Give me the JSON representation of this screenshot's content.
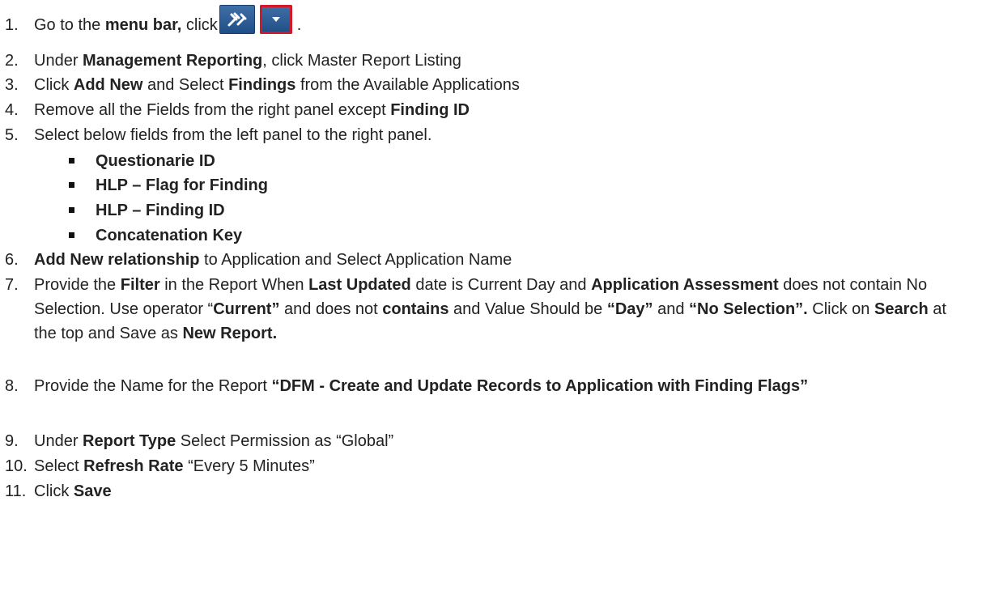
{
  "steps": {
    "s1": {
      "num": "1.",
      "pre": "Go to the ",
      "menu_bar": "menu bar,",
      "click": " click",
      "after_icons": "."
    },
    "s2": {
      "num": "2.",
      "pre": "Under ",
      "b1": "Management Reporting",
      "rest": ", click Master Report Listing"
    },
    "s3": {
      "num": "3.",
      "pre": "Click ",
      "b1": "Add New",
      "mid": " and Select ",
      "b2": "Findings",
      "rest": " from the Available Applications"
    },
    "s4": {
      "num": "4.",
      "pre": "Remove all the Fields from the right panel except ",
      "b1": "Finding ID"
    },
    "s5": {
      "num": "5.",
      "text": "Select below fields from the left panel to the right panel."
    },
    "bullets": [
      "Questionarie ID",
      "HLP – Flag for Finding",
      "HLP – Finding ID",
      "Concatenation Key"
    ],
    "s6": {
      "num": "6.",
      "b1": "Add New relationship",
      "rest": " to Application and Select Application Name"
    },
    "s7": {
      "num": "7.",
      "t1": "Provide the ",
      "b1": "Filter",
      "t2": " in the Report When ",
      "b2": "Last Updated",
      "t3": " date is Current Day and ",
      "b3": "Application Assessment",
      "t4": " does not contain No Selection. Use operator “",
      "b4": "Current”",
      "t5": " and does not ",
      "b5": "contains",
      "t6": " and Value Should be ",
      "b6": "“Day”",
      "t7": " and ",
      "b7": "“No Selection”.",
      "t8": "  Click on ",
      "b8": "Search",
      "t9": " at the top and Save as ",
      "b9": "New Report."
    },
    "s8": {
      "num": "8.",
      "pre": "Provide the Name for the Report ",
      "b1": "“DFM - Create and Update Records to Application with Finding Flags”"
    },
    "s9": {
      "num": "9.",
      "pre": "Under ",
      "b1": "Report Type",
      "rest": " Select Permission as “Global”"
    },
    "s10": {
      "num": "10.",
      "pre": "Select ",
      "b1": "Refresh Rate",
      "rest": " “Every 5 Minutes”"
    },
    "s11": {
      "num": "11.",
      "pre": "Click ",
      "b1": "Save"
    }
  },
  "icons": [
    "tools-icon",
    "dropdown-arrow-icon"
  ],
  "colors": {
    "button_blue": "#2f5f97",
    "highlight_red": "#d0192b",
    "text": "#222222"
  }
}
